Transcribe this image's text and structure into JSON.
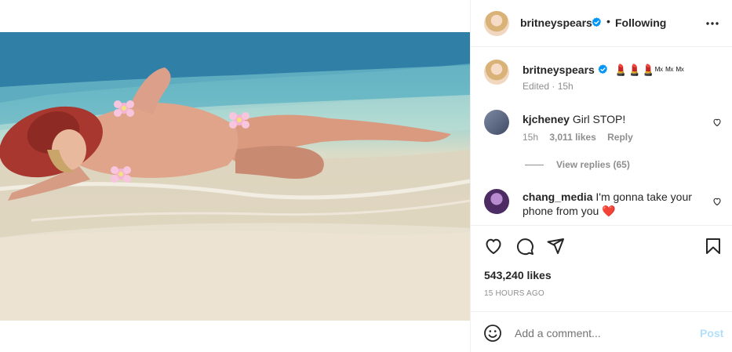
{
  "post": {
    "author": "britneyspears",
    "follow_dot": "•",
    "follow_status": "Following",
    "caption_emojis": "💄💄💄",
    "caption_suffix": "ᴹˣ ᴹˣ ᴹˣ",
    "caption_meta": "Edited · 15h",
    "likes": "543,240 likes",
    "time_ago": "15 HOURS AGO"
  },
  "comments": [
    {
      "user": "kjcheney",
      "text": "Girl STOP!",
      "time": "15h",
      "likes": "3,011 likes",
      "reply_label": "Reply",
      "view_replies": "View replies (65)"
    },
    {
      "user": "chang_media",
      "text": "I'm gonna take your phone from you",
      "emoji": "❤️"
    }
  ],
  "composer": {
    "placeholder": "Add a comment...",
    "post_label": "Post"
  },
  "colors": {
    "verified_blue": "#0095f6",
    "post_disabled": "#b2dffc",
    "secondary_text": "#8e8e8e"
  },
  "icons": [
    "more-options-icon",
    "verified-icon",
    "heart-icon",
    "comment-icon",
    "share-icon",
    "bookmark-icon",
    "emoji-icon"
  ]
}
